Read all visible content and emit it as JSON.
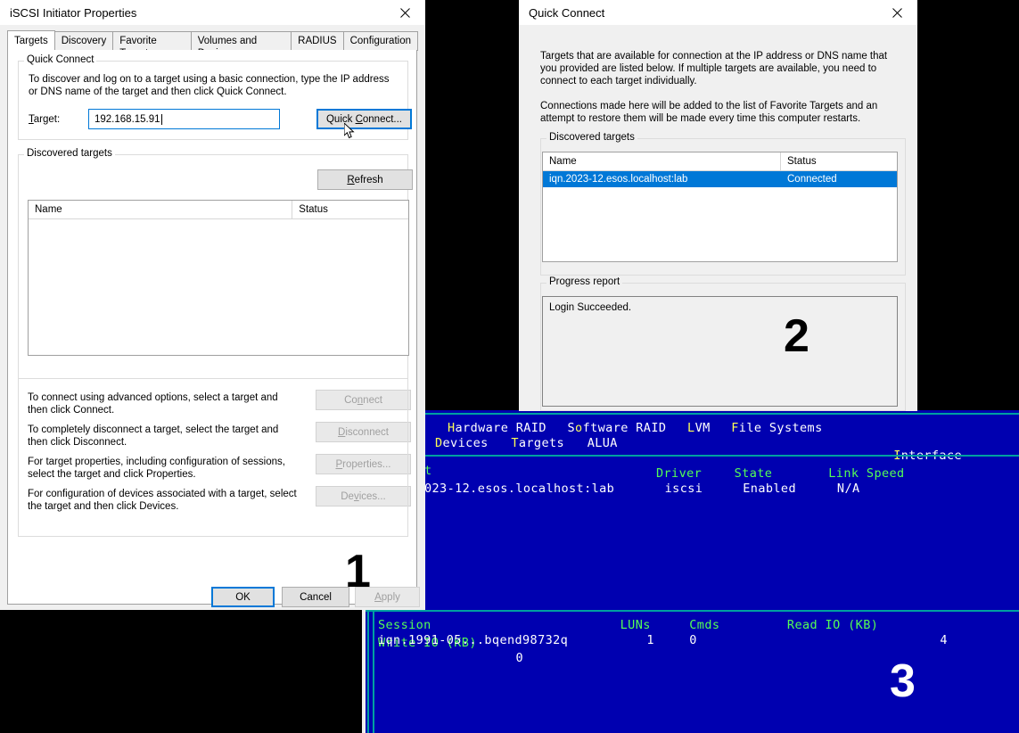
{
  "iscsi": {
    "title": "iSCSI Initiator Properties",
    "close_icon": "close-icon",
    "tabs": [
      {
        "label": "Targets",
        "active": true
      },
      {
        "label": "Discovery",
        "active": false
      },
      {
        "label": "Favorite Targets",
        "active": false
      },
      {
        "label": "Volumes and Devices",
        "active": false
      },
      {
        "label": "RADIUS",
        "active": false
      },
      {
        "label": "Configuration",
        "active": false
      }
    ],
    "quick_connect_group": {
      "label": "Quick Connect",
      "description": "To discover and log on to a target using a basic connection, type the IP address or DNS name of the target and then click Quick Connect.",
      "target_label": "Target:",
      "target_value": "192.168.15.91",
      "target_placeholder": "",
      "button_label": "Quick Connect..."
    },
    "discovered_group": {
      "label": "Discovered targets",
      "refresh_label": "Refresh",
      "columns": [
        "Name",
        "Status"
      ],
      "rows": []
    },
    "actions": [
      {
        "text": "To connect using advanced options, select a target and then click Connect.",
        "button": "Connect",
        "enabled": false
      },
      {
        "text": "To completely disconnect a target, select the target and then click Disconnect.",
        "button": "Disconnect",
        "enabled": false
      },
      {
        "text": "For target properties, including configuration of sessions, select the target and click Properties.",
        "button": "Properties...",
        "enabled": false
      },
      {
        "text": "For configuration of devices associated with a target, select the target and then click Devices.",
        "button": "Devices...",
        "enabled": false
      }
    ],
    "footer": {
      "ok": "OK",
      "cancel": "Cancel",
      "apply": "Apply"
    },
    "step_badge": "1"
  },
  "quick_connect": {
    "title": "Quick Connect",
    "close_icon": "close-icon",
    "paragraph1": "Targets that are available for connection at the IP address or DNS name that you provided are listed below.  If multiple targets are available, you need to connect to each target individually.",
    "paragraph2": "Connections made here will be added to the list of Favorite Targets and an attempt to restore them will be made every time this computer restarts.",
    "discovered_group": {
      "label": "Discovered targets",
      "columns": [
        "Name",
        "Status"
      ],
      "rows": [
        {
          "name": "iqn.2023-12.esos.localhost:lab",
          "status": "Connected",
          "selected": true
        }
      ]
    },
    "progress_group": {
      "label": "Progress report",
      "message": "Login Succeeded."
    },
    "step_badge": "2"
  },
  "terminal_top": {
    "menu_row1": [
      {
        "accel": "H",
        "rest": "ardware RAID"
      },
      {
        "accel": "So",
        "rest": "ftware RAID",
        "accel_char": "o"
      },
      {
        "accel": "L",
        "rest": "VM"
      },
      {
        "accel": "F",
        "rest": "ile Systems"
      }
    ],
    "menu_row1_raw": "Hardware RAID   Software RAID   LVM   File Systems",
    "menu_row2_raw": "Devices   Targets   ALUA",
    "menu_row2_right": "Interface",
    "table_headers": [
      "Driver",
      "State",
      "Link Speed"
    ],
    "partial_header": "t",
    "row_name": "023-12.esos.localhost:lab",
    "row_driver": "iscsi",
    "row_state": "Enabled",
    "row_link_speed": "N/A"
  },
  "terminal_bottom": {
    "headers": [
      "Session",
      "LUNs",
      "Cmds",
      "Read IO (KB)",
      "Write IO (KB)"
    ],
    "row": {
      "session": "iqn.1991-05...bqend98732q",
      "luns": "1",
      "cmds": "0",
      "read_io": "4",
      "write_io": "0"
    },
    "step_badge": "3"
  },
  "colors": {
    "accent": "#0078d7",
    "terminal_bg": "#0000b0",
    "terminal_rule": "#00a0a0",
    "terminal_green": "#55ff55",
    "terminal_yellow": "#ffff55",
    "window_bg": "#f0f0f0"
  }
}
